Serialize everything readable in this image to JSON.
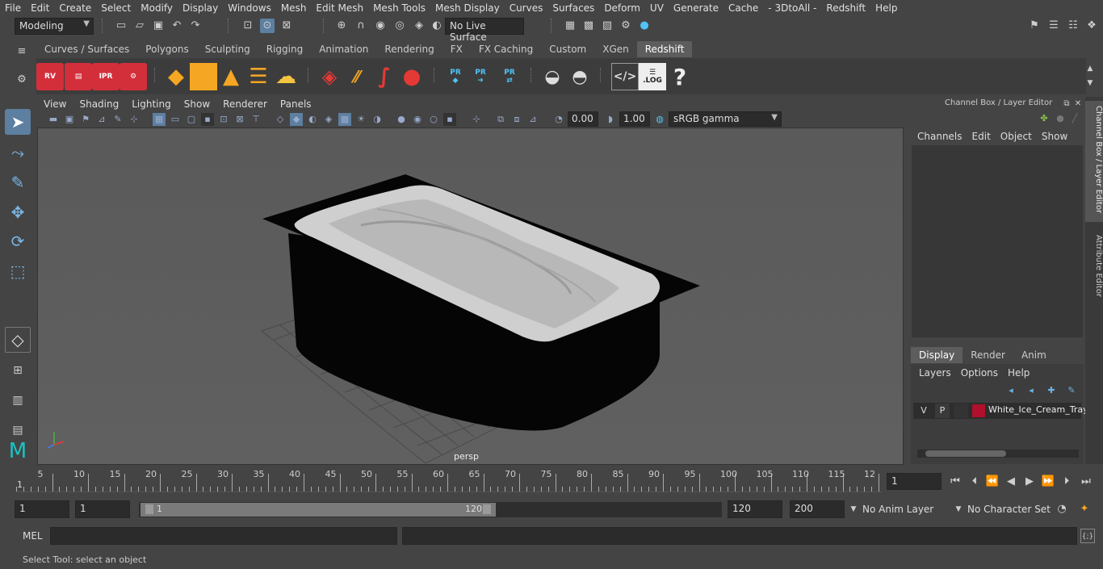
{
  "menu": [
    "File",
    "Edit",
    "Create",
    "Select",
    "Modify",
    "Display",
    "Windows",
    "Mesh",
    "Edit Mesh",
    "Mesh Tools",
    "Mesh Display",
    "Curves",
    "Surfaces",
    "Deform",
    "UV",
    "Generate",
    "Cache",
    "- 3DtoAll -",
    "Redshift",
    "Help"
  ],
  "toolbar": {
    "mode": "Modeling",
    "live_surface": "No Live Surface"
  },
  "shelf_tabs": [
    "Curves / Surfaces",
    "Polygons",
    "Sculpting",
    "Rigging",
    "Animation",
    "Rendering",
    "FX",
    "FX Caching",
    "Custom",
    "XGen",
    "Redshift"
  ],
  "shelf_active": "Redshift",
  "shelf_icons": {
    "rv": "RV",
    "ipr": "IPR",
    "pr1": "PR",
    "pr2": "PR",
    "pr3": "PR",
    "log": ".LOG",
    "help": "?"
  },
  "viewport": {
    "menu": [
      "View",
      "Shading",
      "Lighting",
      "Show",
      "Renderer",
      "Panels"
    ],
    "exposure": "0.00",
    "gamma": "1.00",
    "colorspace": "sRGB gamma",
    "camera_label": "persp"
  },
  "channelbox": {
    "title": "Channel Box / Layer Editor",
    "menu": [
      "Channels",
      "Edit",
      "Object",
      "Show"
    ],
    "tabs": [
      "Display",
      "Render",
      "Anim"
    ],
    "layer_menu": [
      "Layers",
      "Options",
      "Help"
    ],
    "layer": {
      "v": "V",
      "p": "P",
      "name": "White_Ice_Cream_Tray",
      "color": "#b0102c"
    }
  },
  "side_tabs": [
    "Channel Box / Layer Editor",
    "Attribute Editor"
  ],
  "timeline": {
    "ticks": [
      "5",
      "10",
      "15",
      "20",
      "25",
      "30",
      "35",
      "40",
      "45",
      "50",
      "55",
      "60",
      "65",
      "70",
      "75",
      "80",
      "85",
      "90",
      "95",
      "100",
      "105",
      "110",
      "115",
      "12"
    ],
    "start_marker": "1",
    "current_frame": "1"
  },
  "range": {
    "start": "1",
    "playback_start": "1",
    "slider_start": "1",
    "slider_end": "120",
    "end": "120",
    "max": "200",
    "anim_layer": "No Anim Layer",
    "character_set": "No Character Set"
  },
  "cmd": {
    "label": "MEL"
  },
  "help_line": "Select Tool: select an object"
}
